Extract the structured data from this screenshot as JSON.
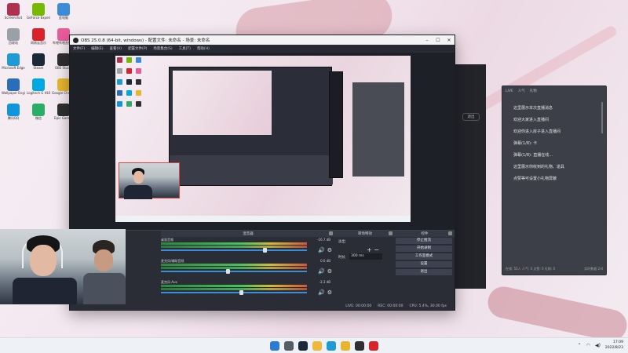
{
  "desktop": {
    "icons": [
      {
        "label": "Screenshot",
        "color": "#b03050"
      },
      {
        "label": "GeForce Experience",
        "color": "#76b900"
      },
      {
        "label": "此电脑",
        "color": "#3c8ad8"
      },
      {
        "label": "回收站",
        "color": "#9aa0a8"
      },
      {
        "label": "网易云音乐",
        "color": "#d8232a"
      },
      {
        "label": "哔哩哔哩直播姬",
        "color": "#e85c9a"
      },
      {
        "label": "Microsoft Edge",
        "color": "#1f9bd4"
      },
      {
        "label": "Steam",
        "color": "#1b2838"
      },
      {
        "label": "OBS Studio",
        "color": "#302e31"
      },
      {
        "label": "Wallpaper Engine",
        "color": "#2a6db8"
      },
      {
        "label": "Logitech G HUB",
        "color": "#00a8e0"
      },
      {
        "label": "Google Chrome",
        "color": "#e9b530"
      },
      {
        "label": "腾讯QQ",
        "color": "#1296db"
      },
      {
        "label": "微信",
        "color": "#2aae67"
      },
      {
        "label": "Epic Games",
        "color": "#2f2f2f"
      }
    ]
  },
  "obs": {
    "title": "OBS 25.0.8 (64-bit, windows) - 配置文件: 未命名 - 场景: 未命名",
    "menu": [
      "文件(F)",
      "编辑(E)",
      "查看(V)",
      "配置文件(P)",
      "场景集合(S)",
      "工具(T)",
      "帮助(H)"
    ],
    "docks": {
      "mixer_title": "混音器",
      "transitions_title": "转场特效",
      "controls_title": "控件"
    },
    "mixer": [
      {
        "name": "桌面音频",
        "db": "-16.7 dB",
        "level": 0.72
      },
      {
        "name": "麦克风/辅助音频",
        "db": "0.0 dB",
        "level": 0.46
      },
      {
        "name": "麦克风 Aux",
        "db": "-2.3 dB",
        "level": 0.55
      }
    ],
    "transition": {
      "type": "淡出",
      "duration_label": "时长",
      "duration": "300 ms"
    },
    "controls": [
      "停止推流",
      "开始录制",
      "工作室模式",
      "设置",
      "退出"
    ],
    "status": {
      "live": "LIVE: 00:00:00",
      "rec": "REC: 00:00:00",
      "cpu": "CPU: 5.4%, 30.00 fps"
    }
  },
  "behind_window": {
    "button": "退出"
  },
  "chat": {
    "header": [
      "LIVE",
      "人气",
      "礼物"
    ],
    "messages": [
      "这里展示本次直播消息",
      "欢迎大家进入直播间",
      "欢迎你进入房子进入直播间",
      "弹幕(1/8): 卡",
      "弹幕(1/8): 直播在线...",
      "这里展示你收到的礼物、道具",
      "点赞等可设置小礼物屏蔽"
    ],
    "footer_left": "在线: 55人 人气: 0 点赞: 0 礼物: 0",
    "footer_right": "实时数据 2/4"
  },
  "taskbar": {
    "apps": [
      {
        "name": "windows-start",
        "color": "#2b7ad6"
      },
      {
        "name": "search",
        "color": "#555c66"
      },
      {
        "name": "steam",
        "color": "#1b2838"
      },
      {
        "name": "file-explorer",
        "color": "#f0b73a"
      },
      {
        "name": "edge",
        "color": "#1f9bd4"
      },
      {
        "name": "chrome",
        "color": "#e9b530"
      },
      {
        "name": "obs",
        "color": "#302e31"
      },
      {
        "name": "netease-music",
        "color": "#d8232a"
      }
    ],
    "time": "17:09",
    "date": "2022/8/23"
  }
}
